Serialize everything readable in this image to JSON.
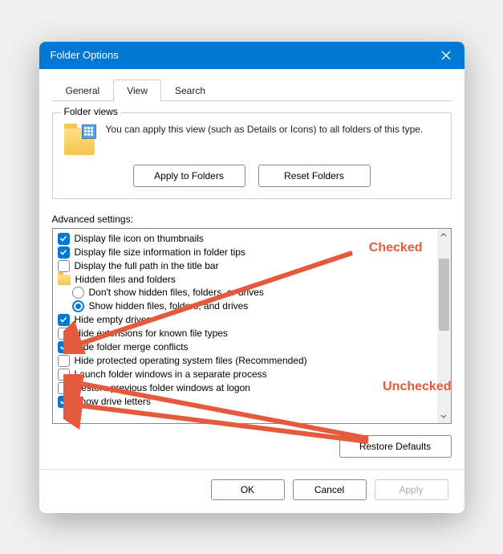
{
  "title": "Folder Options",
  "tabs": {
    "general": "General",
    "view": "View",
    "search": "Search"
  },
  "folder_views": {
    "legend": "Folder views",
    "desc": "You can apply this view (such as Details or Icons) to all folders of this type.",
    "apply_btn": "Apply to Folders",
    "reset_btn": "Reset Folders"
  },
  "advanced": {
    "label": "Advanced settings:",
    "items": {
      "display_file_icon": "Display file icon on thumbnails",
      "display_file_size": "Display file size information in folder tips",
      "display_full_path": "Display the full path in the title bar",
      "hidden_folder": "Hidden files and folders",
      "hidden_radio_hide": "Don't show hidden files, folders, or drives",
      "hidden_radio_show": "Show hidden files, folders, and drives",
      "hide_empty": "Hide empty drives",
      "hide_ext": "Hide extensions for known file types",
      "hide_merge": "Hide folder merge conflicts",
      "hide_os": "Hide protected operating system files (Recommended)",
      "launch_sep": "Launch folder windows in a separate process",
      "restore_prev": "Restore previous folder windows at logon",
      "show_drive": "Show drive letters"
    }
  },
  "buttons": {
    "restore_defaults": "Restore Defaults",
    "ok": "OK",
    "cancel": "Cancel",
    "apply": "Apply"
  },
  "annotations": {
    "checked": "Checked",
    "unchecked": "Unchecked",
    "color": "#e55a3c"
  }
}
